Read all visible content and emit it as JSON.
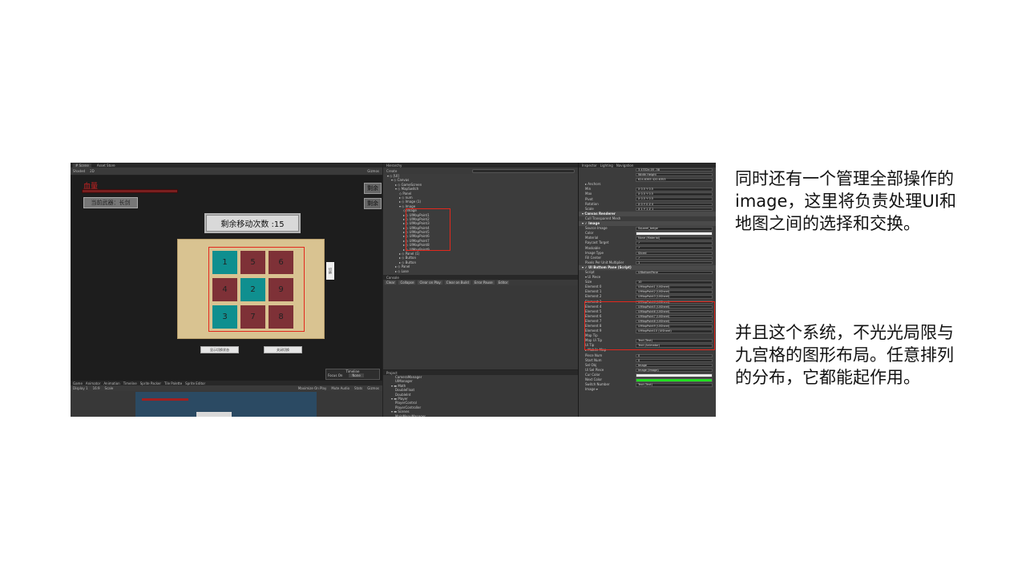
{
  "scene": {
    "tabs": [
      "# Scene",
      "Asset Store"
    ],
    "toolbar": [
      "Shaded",
      "2D",
      "Gizmos"
    ],
    "hp_label": "血量",
    "weapon_label": "当前武器：长剑",
    "right_button_label": "剩余",
    "moves_label": "剩余移动次数 :15",
    "grid": [
      {
        "n": "1",
        "color": "teal"
      },
      {
        "n": "5",
        "color": "red"
      },
      {
        "n": "6",
        "color": "red"
      },
      {
        "n": "4",
        "color": "red"
      },
      {
        "n": "2",
        "color": "teal"
      },
      {
        "n": "9",
        "color": "red"
      },
      {
        "n": "3",
        "color": "teal"
      },
      {
        "n": "7",
        "color": "red"
      },
      {
        "n": "8",
        "color": "red"
      }
    ],
    "side_tag": "切换",
    "btn_left": "显示切换状态",
    "btn_right": "关闭切换",
    "timeline_title": "Timeline",
    "timeline_focus": "Focus On",
    "timeline_value": "None"
  },
  "game": {
    "tabs": [
      "Game",
      "Animator",
      "Animation",
      "Timeline",
      "Sprite Packer",
      "Tile Palette",
      "Sprite Editor"
    ],
    "options": [
      "Display 1",
      "16:9",
      "Scale",
      "Maximize On Play",
      "Mute Audio",
      "Stats",
      "Gizmos"
    ]
  },
  "hierarchy": {
    "title": "Hierarchy",
    "create": "Create",
    "rows": [
      {
        "indent": 1,
        "text": "▾ ◇ [UI]"
      },
      {
        "indent": 2,
        "text": "▾ ◇ Canvas"
      },
      {
        "indent": 3,
        "text": "▸ ◇ GameScreen"
      },
      {
        "indent": 3,
        "text": "▾ ◇ MapSwitch"
      },
      {
        "indent": 4,
        "text": "◇ Panel"
      },
      {
        "indent": 4,
        "text": "▸ ◇ num"
      },
      {
        "indent": 4,
        "text": "▸ ◇ Image (1)"
      },
      {
        "indent": 4,
        "text": "▾ ◇ Image"
      },
      {
        "indent": 5,
        "text": "◇ Image"
      },
      {
        "indent": 5,
        "text": "▸ ◇ UIMapPoint1"
      },
      {
        "indent": 5,
        "text": "▸ ◇ UIMapPoint2"
      },
      {
        "indent": 5,
        "text": "▸ ◇ UIMapPoint3"
      },
      {
        "indent": 5,
        "text": "▸ ◇ UIMapPoint4"
      },
      {
        "indent": 5,
        "text": "▸ ◇ UIMapPoint5"
      },
      {
        "indent": 5,
        "text": "▸ ◇ UIMapPoint6"
      },
      {
        "indent": 5,
        "text": "▸ ◇ UIMapPoint7"
      },
      {
        "indent": 5,
        "text": "▸ ◇ UIMapPoint8"
      },
      {
        "indent": 5,
        "text": "▸ ◇ UIMapPoint9"
      },
      {
        "indent": 4,
        "text": "▸ ◇ Panel (1)"
      },
      {
        "indent": 4,
        "text": "▸ ◇ Button"
      },
      {
        "indent": 4,
        "text": "▸ ◇ Button"
      },
      {
        "indent": 3,
        "text": "▸ ◇ Panel"
      },
      {
        "indent": 3,
        "text": "▸ ◇ Lose"
      }
    ]
  },
  "console": {
    "title": "Console",
    "buttons": [
      "Clear",
      "Collapse",
      "Clear on Play",
      "Clear on Build",
      "Error Pause",
      "Editor"
    ]
  },
  "project": {
    "title": "Project",
    "rows": [
      {
        "indent": 3,
        "text": "CameraManager"
      },
      {
        "indent": 3,
        "text": "UIManager"
      },
      {
        "indent": 2,
        "text": "▾ ▬ Math"
      },
      {
        "indent": 3,
        "text": "DoubleFloat"
      },
      {
        "indent": 3,
        "text": "DoubleInt"
      },
      {
        "indent": 2,
        "text": "▾ ▬ Player"
      },
      {
        "indent": 3,
        "text": "PlayerControl"
      },
      {
        "indent": 3,
        "text": "PlayerController"
      },
      {
        "indent": 2,
        "text": "▾ ▬ Scenes"
      },
      {
        "indent": 3,
        "text": "MainMenuManager"
      }
    ]
  },
  "inspector": {
    "tabs": [
      "Inspector",
      "Lighting",
      "Navigation"
    ],
    "rows": [
      {
        "type": "row",
        "label": "",
        "value": "3.4332e-05    -38"
      },
      {
        "type": "row",
        "label": "",
        "value": "Width    Height"
      },
      {
        "type": "row",
        "label": "",
        "value": "624.6365    420.6353"
      },
      {
        "type": "row",
        "label": "▸ Anchors",
        "value": ""
      },
      {
        "type": "row",
        "label": "Min",
        "value": "X 0.5    Y 0.5"
      },
      {
        "type": "row",
        "label": "Max",
        "value": "X 0.5    Y 0.5"
      },
      {
        "type": "row",
        "label": "Pivot",
        "value": "X 0.5    Y 0.5"
      },
      {
        "type": "row",
        "label": "Rotation",
        "value": "X 0    Y 0    Z 0"
      },
      {
        "type": "row",
        "label": "Scale",
        "value": "X 1    Y 1    Z 1"
      },
      {
        "type": "hdr",
        "label": "▾ Canvas Renderer",
        "value": ""
      },
      {
        "type": "row",
        "label": "Cull Transparent Mesh",
        "value": ""
      },
      {
        "type": "hdr",
        "label": "▾ ✓ Image",
        "value": ""
      },
      {
        "type": "row",
        "label": "Source Image",
        "value": "Squarel_beige"
      },
      {
        "type": "row",
        "label": "Color",
        "value": "",
        "swatch": "white"
      },
      {
        "type": "row",
        "label": "Material",
        "value": "None (Material)"
      },
      {
        "type": "row",
        "label": "Raycast Target",
        "value": "✓"
      },
      {
        "type": "row",
        "label": "Maskable",
        "value": "✓"
      },
      {
        "type": "row",
        "label": "Image Type",
        "value": "Sliced"
      },
      {
        "type": "row",
        "label": "Fill Center",
        "value": "✓"
      },
      {
        "type": "row",
        "label": "Pixels Per Unit Multiplier",
        "value": "1"
      },
      {
        "type": "hdr",
        "label": "▾ ✓ UI Bottom Pane (Script)",
        "value": ""
      },
      {
        "type": "row",
        "label": "Script",
        "value": "UIBottomPane"
      },
      {
        "type": "row",
        "label": "▾ Ui Piece",
        "value": ""
      },
      {
        "type": "row",
        "label": "Size",
        "value": "10"
      },
      {
        "type": "row",
        "label": "Element 0",
        "value": "UIMapPoint1 (UISheet)"
      },
      {
        "type": "row",
        "label": "Element 1",
        "value": "UIMapPoint2 (UISheet)"
      },
      {
        "type": "row",
        "label": "Element 2",
        "value": "UIMapPoint3 (UISheet)"
      },
      {
        "type": "row",
        "label": "Element 3",
        "value": "UIMapPoint4 (UISheet)"
      },
      {
        "type": "row",
        "label": "Element 4",
        "value": "UIMapPoint5 (UISheet)"
      },
      {
        "type": "row",
        "label": "Element 5",
        "value": "UIMapPoint6 (UISheet)"
      },
      {
        "type": "row",
        "label": "Element 6",
        "value": "UIMapPoint7 (UISheet)"
      },
      {
        "type": "row",
        "label": "Element 7",
        "value": "UIMapPoint8 (UISheet)"
      },
      {
        "type": "row",
        "label": "Element 8",
        "value": "UIMapPoint9 (UISheet)"
      },
      {
        "type": "row",
        "label": "Element 9",
        "value": "UIMapPoint10 (UISheet)"
      },
      {
        "type": "row",
        "label": "Map Tip",
        "value": ""
      },
      {
        "type": "row",
        "label": "Map Ui Tip",
        "value": "Text (Text)"
      },
      {
        "type": "row",
        "label": "Ui Tip",
        "value": "Text (Animator)"
      },
      {
        "type": "row",
        "label": "▸ Mobile Map",
        "value": ""
      },
      {
        "type": "row",
        "label": "Piece Num",
        "value": "0"
      },
      {
        "type": "row",
        "label": "Start Num",
        "value": "0"
      },
      {
        "type": "row",
        "label": "Sel Obj",
        "value": "Image"
      },
      {
        "type": "row",
        "label": "Ui Sel Piece",
        "value": "Image (Image)"
      },
      {
        "type": "row",
        "label": "Cur Color",
        "value": "",
        "swatch": "white"
      },
      {
        "type": "row",
        "label": "Next Color",
        "value": "",
        "swatch": "green"
      },
      {
        "type": "row",
        "label": "Switch Number",
        "value": "Text (Text)"
      },
      {
        "type": "row",
        "label": "Image ▾",
        "value": ""
      }
    ]
  },
  "notes": {
    "paragraph1": "同时还有一个管理全部操作的image，这里将负责处理UI和地图之间的选择和交换。",
    "paragraph2": "并且这个系统，不光光局限与九宫格的图形布局。任意排列的分布，它都能起作用。"
  }
}
